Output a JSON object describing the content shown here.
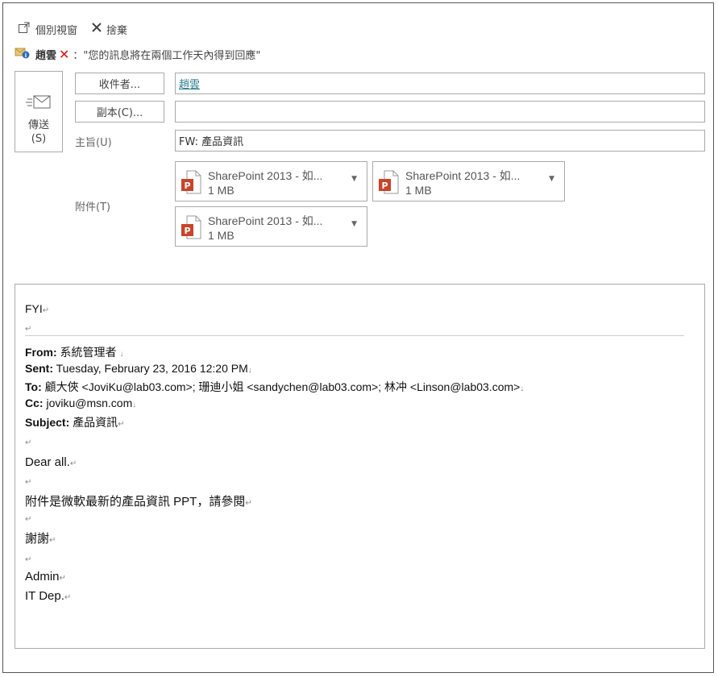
{
  "toolbar": {
    "popout_label": "個別視窗",
    "discard_label": "捨棄"
  },
  "infobar": {
    "name": "趙雲",
    "message": "：\"您的訊息將在兩個工作天內得到回應\""
  },
  "send": {
    "label_line1": "傳送",
    "label_line2": "(S)"
  },
  "to": {
    "button": "收件者...",
    "value": "趙雲"
  },
  "cc": {
    "button": "副本(C)...",
    "value": ""
  },
  "subject": {
    "label": "主旨(U)",
    "value": "FW: 產品資訊"
  },
  "attachments": {
    "label": "附件(T)",
    "items": [
      {
        "name": "SharePoint 2013 - 如...",
        "size": "1 MB"
      },
      {
        "name": "SharePoint 2013 - 如...",
        "size": "1 MB"
      },
      {
        "name": "SharePoint 2013 - 如...",
        "size": "1 MB"
      }
    ]
  },
  "body": {
    "fyi": "FYI",
    "from_label": "From:",
    "from_value": " 系統管理者 ",
    "sent_label": "Sent:",
    "sent_value": " Tuesday, February 23, 2016 12:20 PM",
    "to_label": "To:",
    "to_value": " 顧大俠 <JoviKu@lab03.com>; 珊迪小姐 <sandychen@lab03.com>; 林冲 <Linson@lab03.com>",
    "cc_label": "Cc:",
    "cc_value": " joviku@msn.com",
    "subject_label": "Subject:",
    "subject_value": " 產品資訊",
    "greeting": "Dear all.",
    "content": "附件是微軟最新的產品資訊 PPT，請參閱",
    "thanks": "謝謝",
    "sign1": "Admin",
    "sign2": "IT Dep."
  },
  "marks": {
    "para": "↵",
    "line": "↓"
  },
  "colors": {
    "link": "#2a7c8f",
    "error": "#dd1111",
    "ppt": "#c8442a"
  }
}
